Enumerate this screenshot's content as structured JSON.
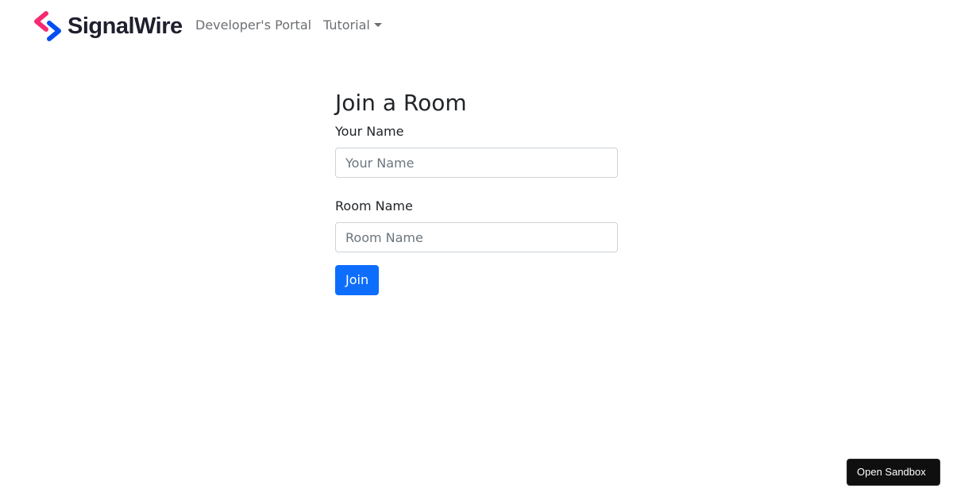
{
  "navbar": {
    "brand_name": "SignalWire",
    "logo_icon": "signalwire-logo-icon",
    "links": [
      {
        "label": "Developer's Portal"
      },
      {
        "label": "Tutorial",
        "icon": "caret-down-icon"
      }
    ]
  },
  "form": {
    "title": "Join a Room",
    "your_name": {
      "label": "Your Name",
      "value": "",
      "placeholder": "Your Name"
    },
    "room_name": {
      "label": "Room Name",
      "value": "",
      "placeholder": "Room Name"
    },
    "join_label": "Join"
  },
  "sandbox": {
    "label": "Open Sandbox"
  },
  "colors": {
    "primary": "#0d6efd",
    "nav_text": "#6c6f73",
    "logo_red": "#f72a72",
    "logo_blue": "#044ef4"
  }
}
